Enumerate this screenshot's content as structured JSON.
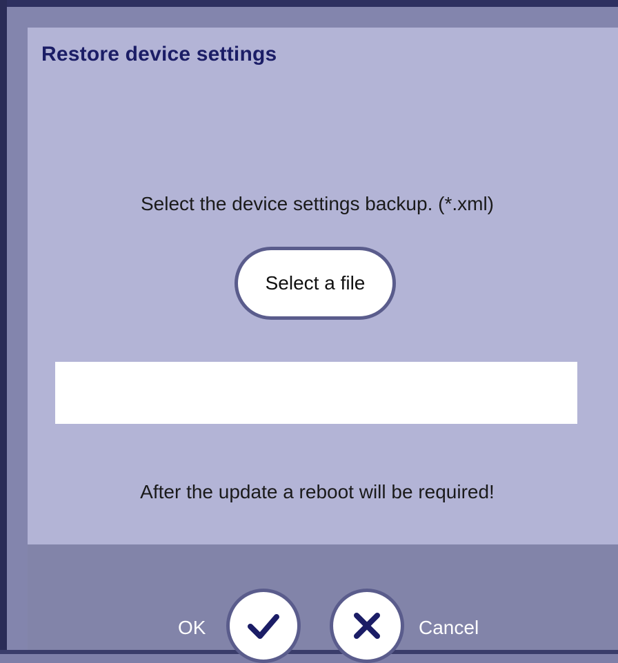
{
  "dialog": {
    "title": "Restore device settings",
    "instruction": "Select the device settings backup. (*.xml)",
    "select_file_label": "Select a file",
    "file_field": {
      "value": "",
      "placeholder": ""
    },
    "reboot_note": "After the update a reboot will be required!"
  },
  "footer": {
    "ok_label": "OK",
    "ok_icon": "checkmark-icon",
    "cancel_label": "Cancel",
    "cancel_icon": "close-icon"
  },
  "colors": {
    "dialog_background": "#b3b4d6",
    "title_text": "#1b1d66",
    "footer_background": "#8284a9",
    "button_border": "#5a5c8c",
    "icon_color": "#1b1d66"
  }
}
